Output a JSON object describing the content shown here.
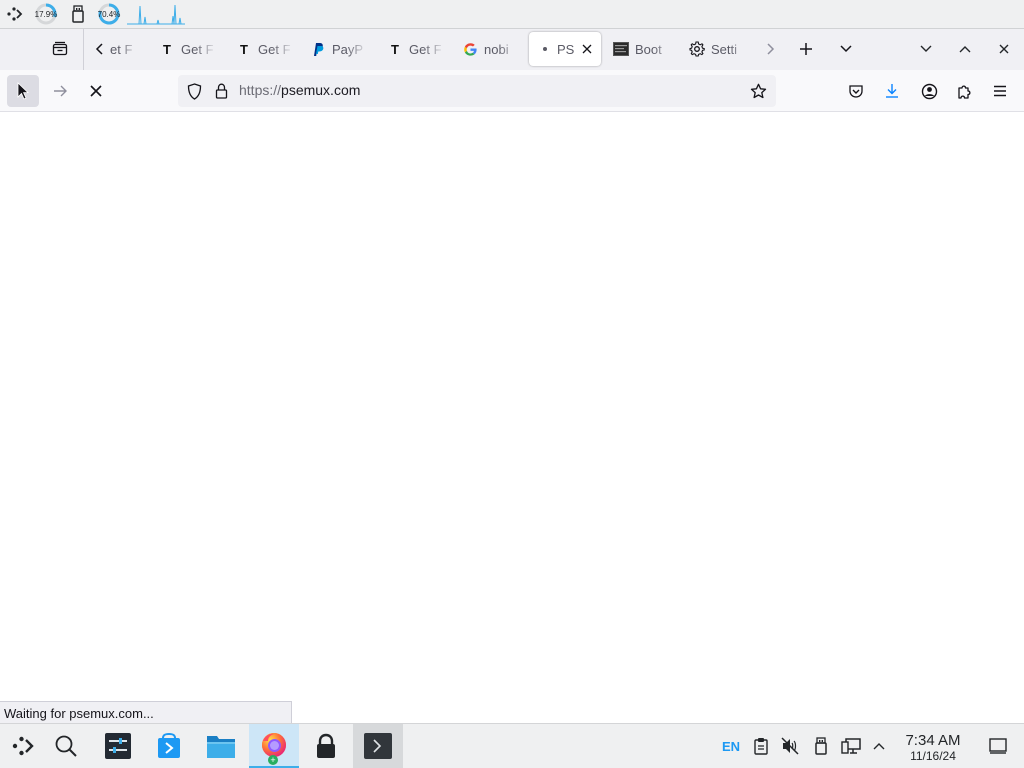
{
  "top_panel": {
    "cpu_gauge": "17.9%",
    "mem_gauge": "70.4%"
  },
  "tabs": [
    {
      "label": "et F",
      "icon": "blank-favicon"
    },
    {
      "label": "Get F",
      "icon": "t-favicon"
    },
    {
      "label": "Get F",
      "icon": "t-favicon"
    },
    {
      "label": "PayP",
      "icon": "paypal-favicon"
    },
    {
      "label": "Get F",
      "icon": "t-favicon"
    },
    {
      "label": "nobi",
      "icon": "google-favicon"
    },
    {
      "label": "PS",
      "icon": "loading-dot",
      "active": true
    },
    {
      "label": "Boot",
      "icon": "terminal-favicon"
    },
    {
      "label": "Setti",
      "icon": "gear-icon"
    }
  ],
  "navbar": {
    "url_scheme": "https://",
    "url_host": "psemux.com"
  },
  "status_text": "Waiting for psemux.com...",
  "taskbar": {
    "keyboard_layout": "EN",
    "time": "7:34 AM",
    "date": "11/16/24"
  },
  "colors": {
    "accent": "#3daee9",
    "download_blue": "#0a84ff",
    "panel_bg": "#eff0f1",
    "tabbar_bg": "#f0f0f4"
  }
}
